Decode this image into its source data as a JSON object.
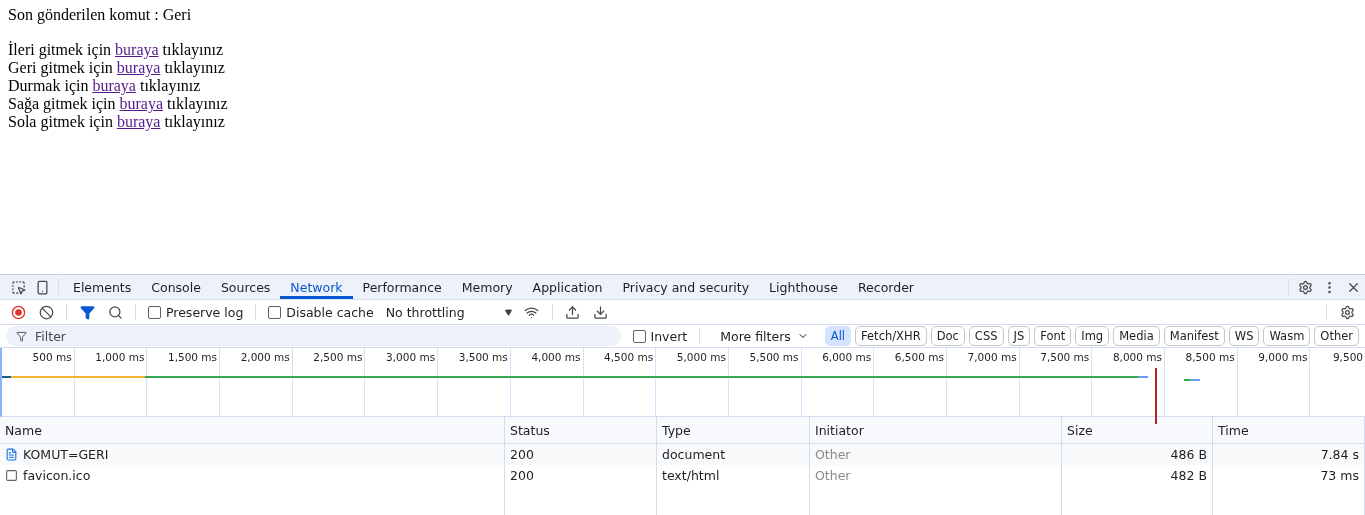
{
  "page": {
    "last_command": "Son gönderilen komut : Geri",
    "commands": [
      {
        "before": "İleri gitmek için",
        "link": "buraya",
        "after": "tıklayınız"
      },
      {
        "before": "Geri gitmek için",
        "link": "buraya",
        "after": "tıklayınız"
      },
      {
        "before": "Durmak için",
        "link": "buraya",
        "after": "tıklayınız"
      },
      {
        "before": "Sağa gitmek için",
        "link": "buraya",
        "after": "tıklayınız"
      },
      {
        "before": "Sola gitmek için",
        "link": "buraya",
        "after": "tıklayınız"
      }
    ]
  },
  "devtools": {
    "tabs": [
      {
        "label": "Elements",
        "selected": false
      },
      {
        "label": "Console",
        "selected": false
      },
      {
        "label": "Sources",
        "selected": false
      },
      {
        "label": "Network",
        "selected": true
      },
      {
        "label": "Performance",
        "selected": false
      },
      {
        "label": "Memory",
        "selected": false
      },
      {
        "label": "Application",
        "selected": false
      },
      {
        "label": "Privacy and security",
        "selected": false
      },
      {
        "label": "Lighthouse",
        "selected": false
      },
      {
        "label": "Recorder",
        "selected": false
      }
    ],
    "toolbar": {
      "recording": true,
      "preserve_log": {
        "label": "Preserve log",
        "checked": false
      },
      "disable_cache": {
        "label": "Disable cache",
        "checked": false
      },
      "throttling": "No throttling"
    },
    "filter": {
      "placeholder": "Filter",
      "invert": {
        "label": "Invert",
        "checked": false
      },
      "more_filters": "More filters",
      "types": [
        {
          "label": "All",
          "selected": true
        },
        {
          "label": "Fetch/XHR",
          "selected": false
        },
        {
          "label": "Doc",
          "selected": false
        },
        {
          "label": "CSS",
          "selected": false
        },
        {
          "label": "JS",
          "selected": false
        },
        {
          "label": "Font",
          "selected": false
        },
        {
          "label": "Img",
          "selected": false
        },
        {
          "label": "Media",
          "selected": false
        },
        {
          "label": "Manifest",
          "selected": false
        },
        {
          "label": "WS",
          "selected": false
        },
        {
          "label": "Wasm",
          "selected": false
        },
        {
          "label": "Other",
          "selected": false
        }
      ]
    },
    "timeline_ticks": [
      "500 ms",
      "1,000 ms",
      "1,500 ms",
      "2,000 ms",
      "2,500 ms",
      "3,000 ms",
      "3,500 ms",
      "4,000 ms",
      "4,500 ms",
      "5,000 ms",
      "5,500 ms",
      "6,000 ms",
      "6,500 ms",
      "7,000 ms",
      "7,500 ms",
      "8,000 ms",
      "8,500 ms",
      "9,000 ms",
      "9,500"
    ],
    "table": {
      "columns": [
        "Name",
        "Status",
        "Type",
        "Initiator",
        "Size",
        "Time"
      ],
      "rows": [
        {
          "kind": "document",
          "name": "KOMUT=GERI",
          "status": "200",
          "type": "document",
          "initiator": "Other",
          "size": "486 B",
          "time": "7.84 s"
        },
        {
          "kind": "other",
          "name": "favicon.ico",
          "status": "200",
          "type": "text/html",
          "initiator": "Other",
          "size": "482 B",
          "time": "73 ms"
        }
      ]
    }
  }
}
